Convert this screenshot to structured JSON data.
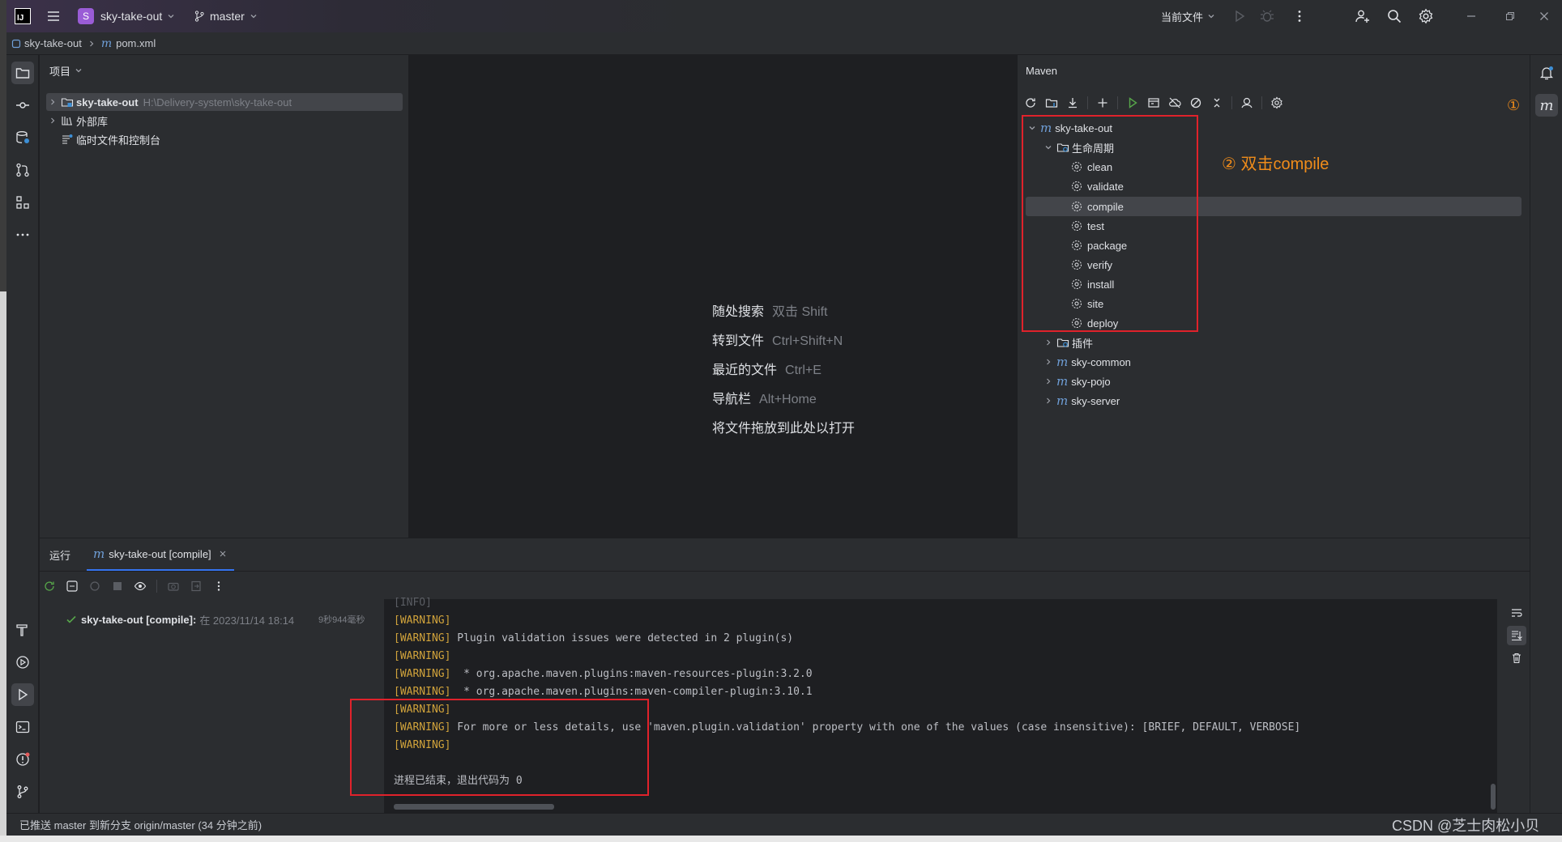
{
  "titlebar": {
    "app_badge": "IJ",
    "project_initial": "S",
    "project_name": "sky-take-out",
    "branch": "master",
    "run_config": "当前文件"
  },
  "breadcrumb": {
    "project": "sky-take-out",
    "file": "pom.xml"
  },
  "project_panel": {
    "title": "项目",
    "items": [
      {
        "label": "sky-take-out",
        "path": "H:\\Delivery-system\\sky-take-out"
      },
      {
        "label": "外部库"
      },
      {
        "label": "临时文件和控制台"
      }
    ]
  },
  "editor_hints": [
    {
      "label": "随处搜索",
      "key": "双击 Shift"
    },
    {
      "label": "转到文件",
      "key": "Ctrl+Shift+N"
    },
    {
      "label": "最近的文件",
      "key": "Ctrl+E"
    },
    {
      "label": "导航栏",
      "key": "Alt+Home"
    },
    {
      "label": "将文件拖放到此处以打开",
      "key": ""
    }
  ],
  "maven": {
    "title": "Maven",
    "root": "sky-take-out",
    "lifecycle_label": "生命周期",
    "goals": [
      "clean",
      "validate",
      "compile",
      "test",
      "package",
      "verify",
      "install",
      "site",
      "deploy"
    ],
    "plugins_label": "插件",
    "modules": [
      "sky-common",
      "sky-pojo",
      "sky-server"
    ]
  },
  "annotations": {
    "step1": "①",
    "step2": "② 双击compile"
  },
  "run": {
    "tab_run": "运行",
    "tab_config": "sky-take-out [compile]",
    "tree_label": "sky-take-out [compile]:",
    "tree_time": "在 2023/11/14 18:14",
    "tree_duration": "9秒944毫秒",
    "console": [
      {
        "tag": "[WARNING]",
        "text": ""
      },
      {
        "tag": "[WARNING]",
        "text": " Plugin validation issues were detected in 2 plugin(s)"
      },
      {
        "tag": "[WARNING]",
        "text": ""
      },
      {
        "tag": "[WARNING]",
        "text": "  * org.apache.maven.plugins:maven-resources-plugin:3.2.0"
      },
      {
        "tag": "[WARNING]",
        "text": "  * org.apache.maven.plugins:maven-compiler-plugin:3.10.1"
      },
      {
        "tag": "[WARNING]",
        "text": ""
      },
      {
        "tag": "[WARNING]",
        "text": " For more or less details, use 'maven.plugin.validation' property with one of the values (case insensitive): [BRIEF, DEFAULT, VERBOSE]"
      },
      {
        "tag": "[WARNING]",
        "text": ""
      },
      {
        "tag": "",
        "text": ""
      },
      {
        "tag": "",
        "text": "进程已结束，退出代码为 0"
      }
    ]
  },
  "statusbar": {
    "message": "已推送 master 到新分支 origin/master (34 分钟之前)",
    "watermark": "CSDN @芝士肉松小贝"
  },
  "colors": {
    "warning": "#d1a33b",
    "annotation": "#f08c1a",
    "highlight_box": "#e0222b",
    "selection": "#43454a"
  }
}
